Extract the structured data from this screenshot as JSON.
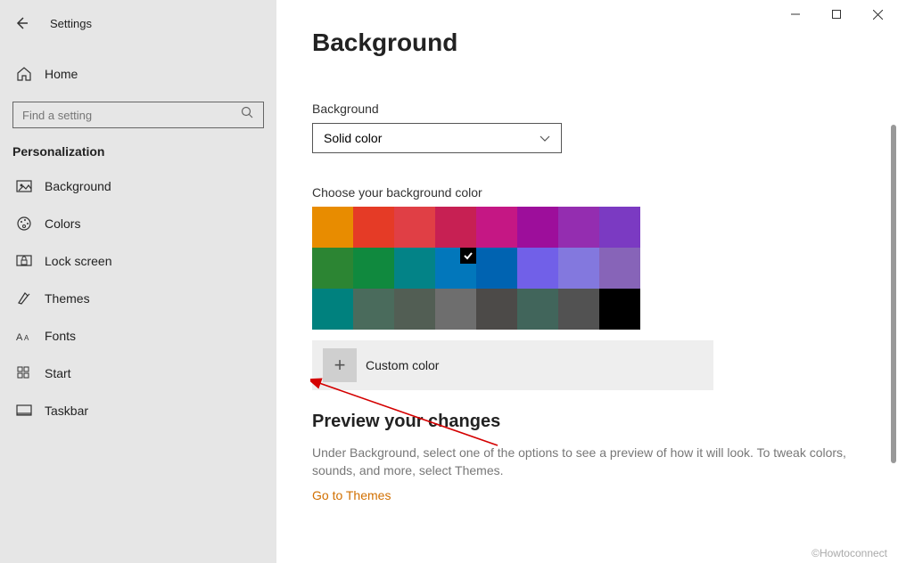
{
  "app": {
    "title": "Settings"
  },
  "sidebar": {
    "home": "Home",
    "searchPlaceholder": "Find a setting",
    "sectionHeader": "Personalization",
    "items": [
      {
        "label": "Background",
        "icon": "picture"
      },
      {
        "label": "Colors",
        "icon": "palette"
      },
      {
        "label": "Lock screen",
        "icon": "lockscreen"
      },
      {
        "label": "Themes",
        "icon": "themes"
      },
      {
        "label": "Fonts",
        "icon": "fonts"
      },
      {
        "label": "Start",
        "icon": "start"
      },
      {
        "label": "Taskbar",
        "icon": "taskbar"
      }
    ]
  },
  "main": {
    "pageTitle": "Background",
    "bgLabel": "Background",
    "bgDropdownValue": "Solid color",
    "chooseColorLabel": "Choose your background color",
    "colors": [
      "#e88c00",
      "#e53b26",
      "#e03f45",
      "#c72053",
      "#c51784",
      "#9d0e9b",
      "#942db0",
      "#7b3ac2",
      "#2c8533",
      "#10893e",
      "#038387",
      "#0277bb",
      "#0063b1",
      "#7160e8",
      "#8378de",
      "#8764b8",
      "#00817e",
      "#4a6b5c",
      "#525e54",
      "#6e6e6e",
      "#4c4a48",
      "#41655b",
      "#525252",
      "#000000"
    ],
    "selectedColorIndex": 11,
    "customColorLabel": "Custom color",
    "previewHeading": "Preview your changes",
    "previewDesc": "Under Background, select one of the options to see a preview of how it will look. To tweak colors, sounds, and more, select Themes.",
    "themesLink": "Go to Themes"
  },
  "watermark": "©Howtoconnect"
}
